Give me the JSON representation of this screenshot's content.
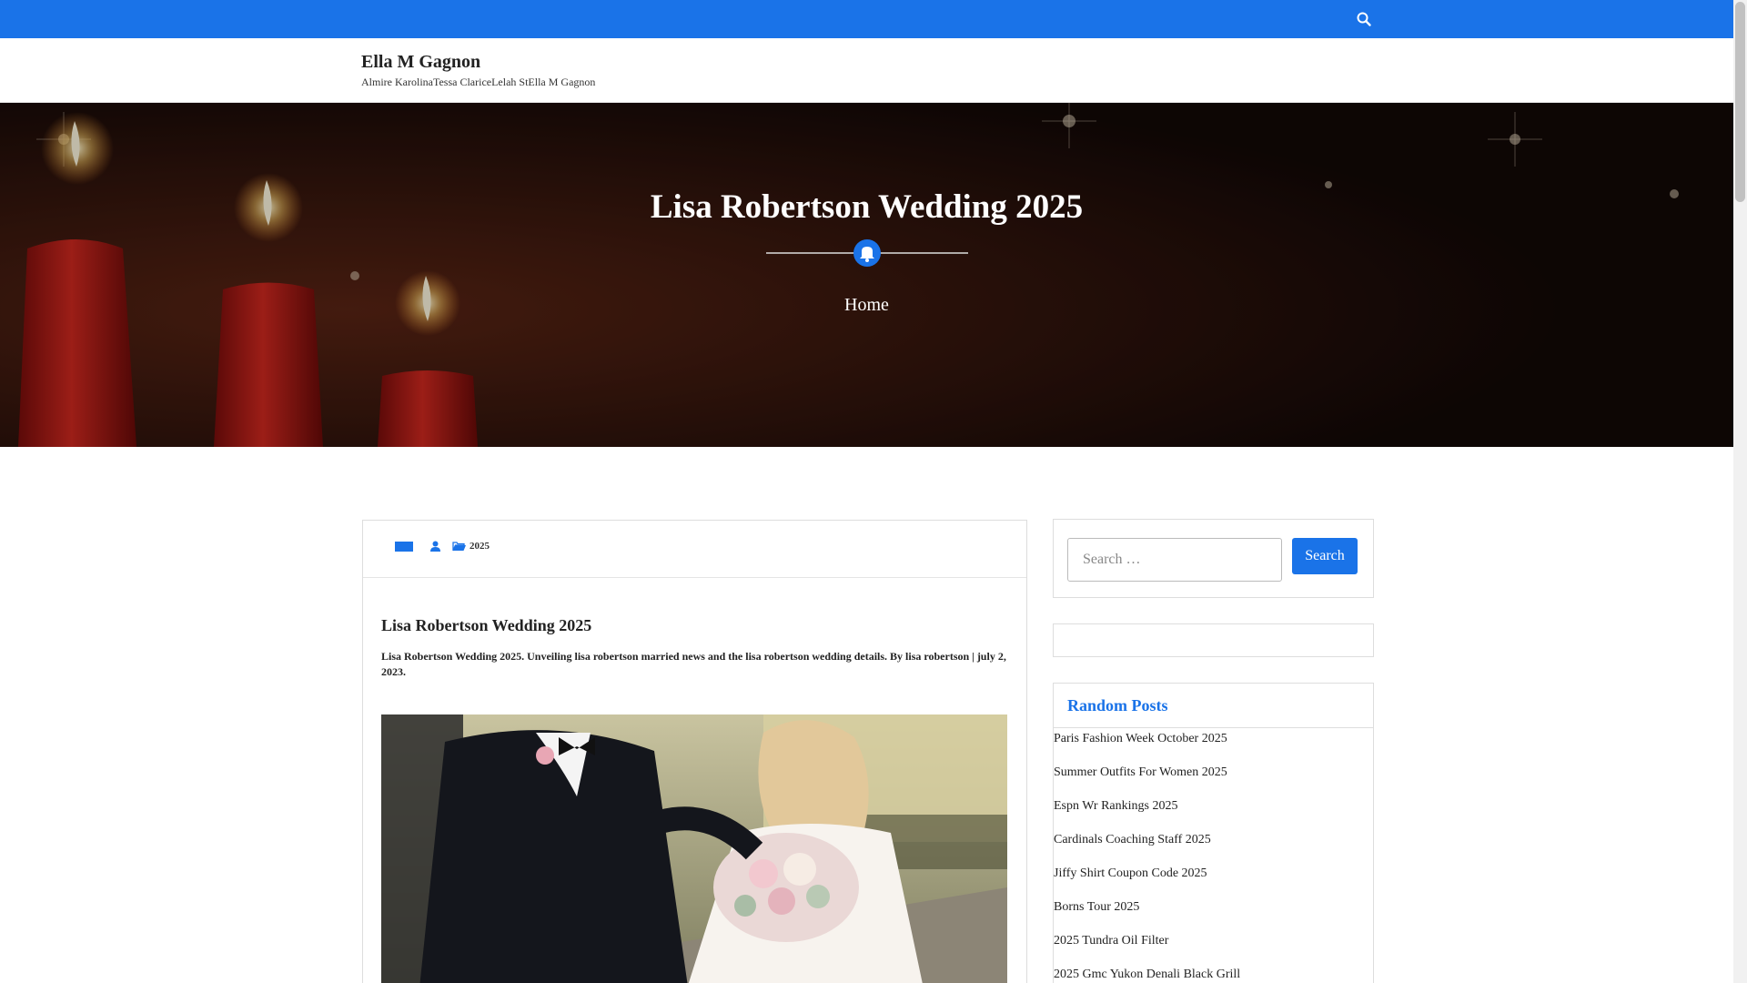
{
  "site": {
    "title": "Ella M Gagnon",
    "description": "Almire KarolinaTessa ClariceLelah StElla M Gagnon"
  },
  "hero": {
    "title": "Lisa Robertson Wedding 2025",
    "breadcrumb": "Home"
  },
  "post": {
    "category": "2025",
    "title": "Lisa Robertson Wedding 2025",
    "excerpt": "Lisa Robertson Wedding 2025. Unveiling lisa robertson married news and the lisa robertson wedding details. By lisa robertson | july 2, 2023."
  },
  "sidebar": {
    "search": {
      "placeholder": "Search …",
      "button_label": "Search"
    },
    "random_posts": {
      "heading": "Random Posts",
      "items": [
        "Paris Fashion Week October 2025",
        "Summer Outfits For Women 2025",
        "Espn Wr Rankings 2025",
        "Cardinals Coaching Staff 2025",
        "Jiffy Shirt Coupon Code 2025",
        "Borns Tour 2025",
        "2025 Tundra Oil Filter",
        "2025 Gmc Yukon Denali Black Grill"
      ]
    }
  },
  "colors": {
    "accent": "#1a73e8",
    "hero_bg": "#1b0e0a",
    "candle": "#c0201c"
  }
}
